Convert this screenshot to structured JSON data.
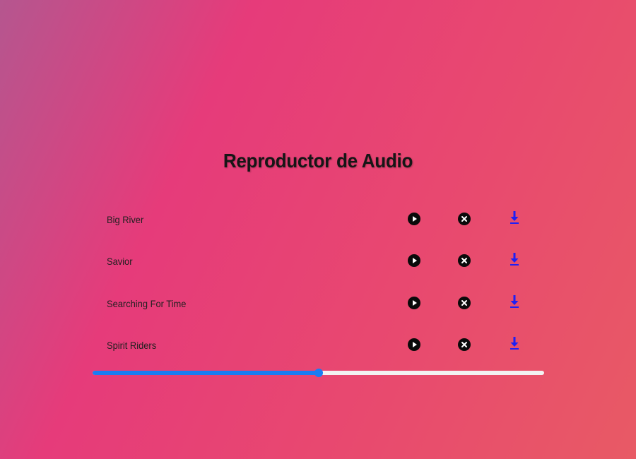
{
  "page": {
    "title": "Reproductor de Audio"
  },
  "tracks": [
    {
      "name": "Big River"
    },
    {
      "name": "Savior"
    },
    {
      "name": "Searching For Time"
    },
    {
      "name": "Spirit Riders"
    }
  ],
  "icons": {
    "play": "play-circle-icon",
    "remove": "close-circle-icon",
    "download": "download-icon"
  },
  "progress": {
    "fraction": 0.5
  },
  "colors": {
    "accent": "#1a7cf2",
    "download": "#1f1ff5",
    "icon_fill": "#0a0a0a",
    "rail": "#f2f2f2"
  }
}
